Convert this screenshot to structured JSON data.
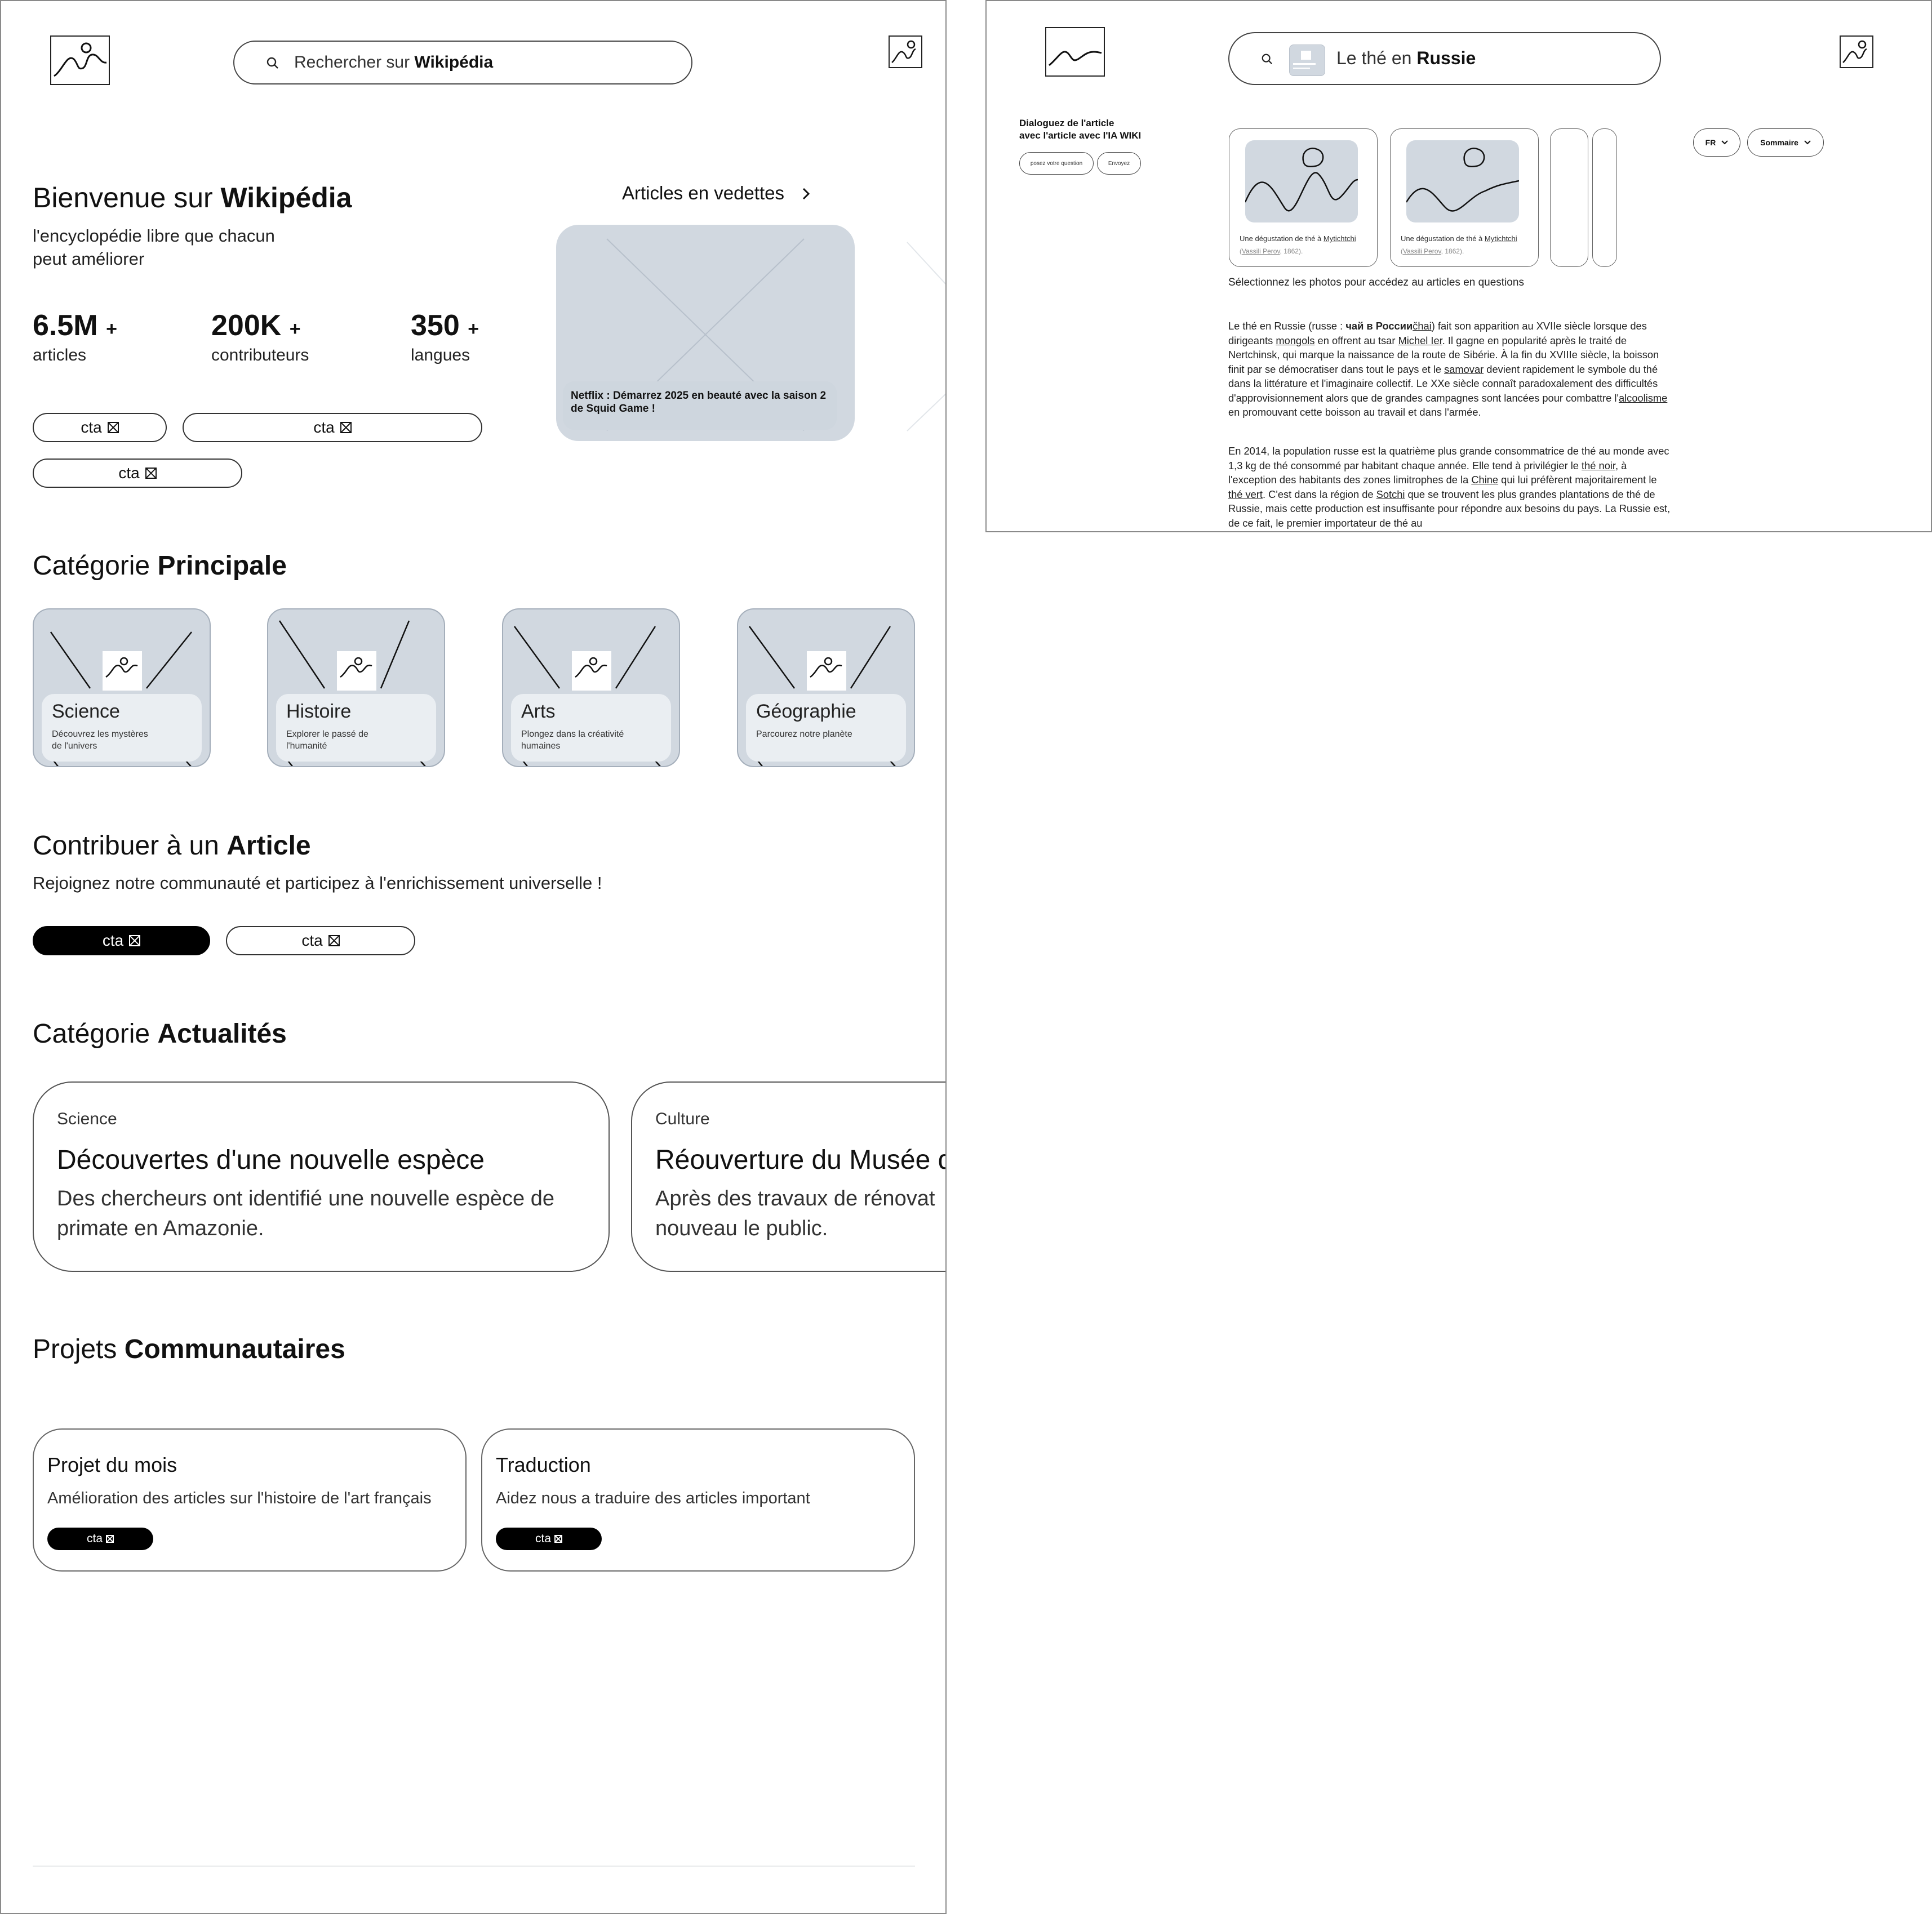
{
  "home": {
    "search_placeholder_prefix": "Rechercher sur ",
    "search_placeholder_bold": "Wikipédia",
    "welcome_prefix": "Bienvenue sur ",
    "welcome_bold": "Wikipédia",
    "tagline_line1": "l'encyclopédie libre que chacun",
    "tagline_line2": "peut améliorer",
    "stats": [
      {
        "value": "6.5M",
        "plus": "+",
        "label": "articles"
      },
      {
        "value": "200K",
        "plus": "+",
        "label": "contributeurs"
      },
      {
        "value": "350",
        "plus": "+",
        "label": "langues"
      }
    ],
    "cta_label": "cta",
    "featured": {
      "title": "Articles en vedettes",
      "chevron": "›",
      "caption": "Netflix : Démarrez 2025 en beauté avec la saison 2 de Squid Game !"
    },
    "categories_heading_prefix": "Catégorie ",
    "categories_heading_bold": "Principale",
    "categories": [
      {
        "title": "Science",
        "desc": "Découvrez les mystères de l'univers"
      },
      {
        "title": "Histoire",
        "desc": "Explorer le passé de l'humanité"
      },
      {
        "title": "Arts",
        "desc": "Plongez dans la créativité humaines"
      },
      {
        "title": "Géographie",
        "desc": "Parcourez notre planète"
      }
    ],
    "contribute_heading_prefix": "Contribuer à un ",
    "contribute_heading_bold": "Article",
    "contribute_desc": "Rejoignez notre communauté et participez  à l'enrichissement universelle !",
    "news_heading_prefix": "Catégorie ",
    "news_heading_bold": "Actualités",
    "news": [
      {
        "tag": "Science",
        "title": "Découvertes d'une nouvelle espèce",
        "desc_line1": "Des chercheurs ont identifié une  nouvelle espèce de",
        "desc_line2": "primate en Amazonie."
      },
      {
        "tag": "Culture",
        "title": "Réouverture du Musée d",
        "desc_line1": "Après des travaux de rénovat",
        "desc_line2": "nouveau le public."
      }
    ],
    "projects_heading_prefix": "Projets ",
    "projects_heading_bold": "Communautaires",
    "projects": [
      {
        "title": "Projet du mois",
        "desc": "Amélioration des articles sur l'histoire de l'art français"
      },
      {
        "title": "Traduction",
        "desc": "Aidez nous a traduire des articles important"
      }
    ]
  },
  "article": {
    "search_prefix": "Le thé en ",
    "search_bold": "Russie",
    "chat_title_line1": "Dialoguez de l'article",
    "chat_title_line2": "avec l'article avec l'IA WIKI",
    "chat_input_placeholder": "posez votre question",
    "chat_send": "Envoyez",
    "lang_select": "FR",
    "summary_select": "Sommaire",
    "thumbs": [
      {
        "caption_prefix": "Une dégustation de thé à ",
        "caption_link": "Mytichtchi",
        "sub_link": "Vassili Perov",
        "sub_rest": ", 1862)."
      },
      {
        "caption_prefix": "Une dégustation de thé à ",
        "caption_link": "Mytichtchi",
        "sub_link": "Vassili Perov",
        "sub_rest": ", 1862)."
      }
    ],
    "select_photos_hint": "Sélectionnez les photos pour accédez au articles en questions",
    "paragraph1": [
      "Le thé en Russie (russe : ",
      {
        "b": "чай в России"
      },
      {
        "u": "čhai"
      },
      ") fait son apparition au XVIIe siècle lorsque des dirigeants ",
      {
        "u": "mongols"
      },
      " en offrent au tsar ",
      {
        "u": "Michel Ier"
      },
      ". Il gagne en popularité après le traité de Nertchinsk, qui marque la naissance de la route de Sibérie. À la fin du XVIIIe siècle, la boisson finit par se démocratiser dans tout le pays et le ",
      {
        "u": "samovar"
      },
      " devient rapidement le symbole du thé dans la littérature et l'imaginaire collectif. Le XXe siècle connaît paradoxalement des difficultés d'approvisionnement alors que de grandes campagnes sont lancées pour combattre l'",
      {
        "u": "alcoolisme"
      },
      " en promouvant cette boisson au travail et dans l'armée."
    ],
    "paragraph2": [
      "En 2014, la population russe est la quatrième plus grande consommatrice de thé au monde avec 1,3 kg de thé consommé par habitant chaque année. Elle tend à privilégier le ",
      {
        "u": "thé noir"
      },
      ", à l'exception des habitants des zones limitrophes de la ",
      {
        "u": "Chine"
      },
      " qui lui préfèrent majoritairement le ",
      {
        "u": "thé vert"
      },
      ". C'est dans la région de ",
      {
        "u": "Sotchi"
      },
      " que se trouvent les plus grandes plantations de thé de Russie, mais cette production est insuffisante pour répondre aux besoins du pays. La Russie est, de ce fait, le premier importateur de thé au"
    ]
  },
  "icons": [
    "logo-icon",
    "search-icon",
    "image-icon",
    "chevron-right-icon",
    "chevron-down-icon",
    "placeholder-x-icon"
  ],
  "colors": {
    "placeholder_fill": "#d1d8e0",
    "card_inner": "#eaeef2",
    "dark_button": "#000000"
  }
}
